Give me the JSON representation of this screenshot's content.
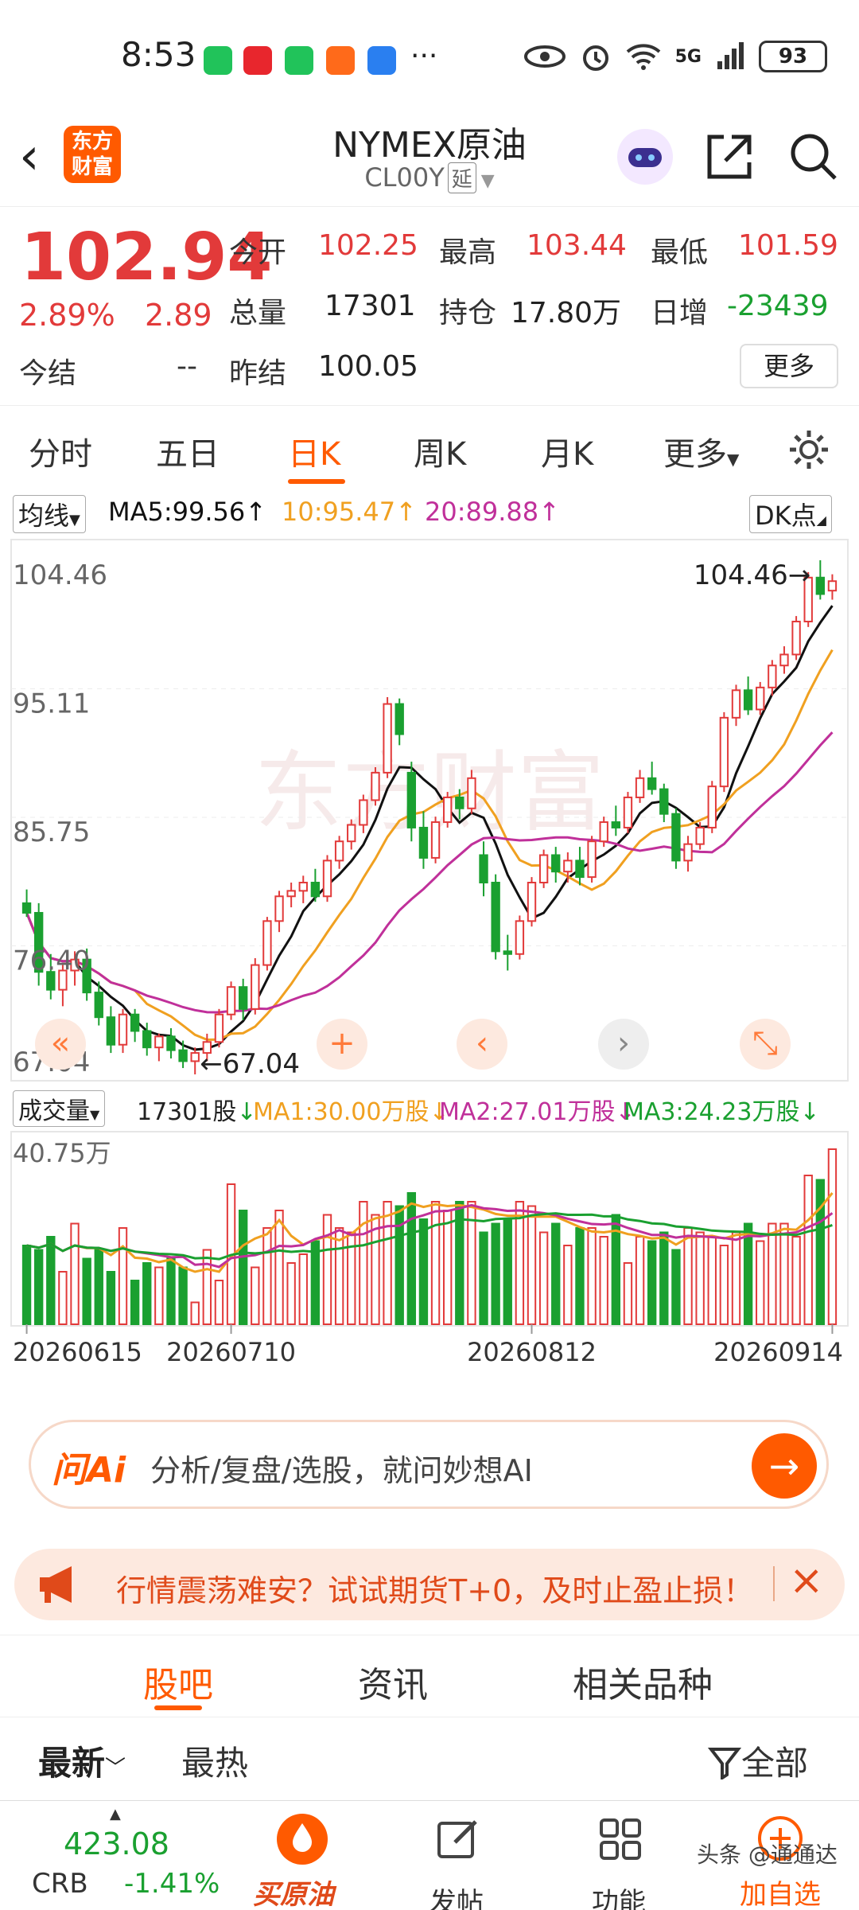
{
  "status_bar": {
    "time": "8:53",
    "more": "···",
    "network": "5G",
    "battery": "93"
  },
  "header": {
    "title": "NYMEX原油",
    "code": "CL00Y",
    "badge": "延",
    "logo_text_top": "东方",
    "logo_text_bottom": "财富"
  },
  "quote": {
    "last": "102.94",
    "change_pct": "2.89%",
    "change": "2.89",
    "open_label": "今开",
    "open": "102.25",
    "high_label": "最高",
    "high": "103.44",
    "low_label": "最低",
    "low": "101.59",
    "volume_label": "总量",
    "volume": "17301",
    "oi_label": "持仓",
    "oi": "17.80万",
    "daily_inc_label": "日增",
    "daily_inc": "-23439",
    "settle_label": "今结",
    "settle": "--",
    "prev_settle_label": "昨结",
    "prev_settle": "100.05",
    "more_button": "更多"
  },
  "tabs": [
    "分时",
    "五日",
    "日K",
    "周K",
    "月K",
    "更多"
  ],
  "ma_bar": {
    "selector": "均线",
    "ma5": "MA5:99.56",
    "ma10": "10:95.47",
    "ma20": "20:89.88",
    "dk": "DK点"
  },
  "colors": {
    "up": "#e23a3a",
    "down": "#1aa030",
    "accent": "#ff5a00",
    "ma5": "#111111",
    "ma10": "#f0a020",
    "ma20": "#c0309a"
  },
  "chart_controls": [
    "«",
    "+",
    "‹",
    "›",
    "⤡"
  ],
  "vol_bar": {
    "selector": "成交量",
    "vol": "17301股",
    "ma1": "MA1:30.00万股",
    "ma2": "MA2:27.01万股",
    "ma3": "MA3:24.23万股"
  },
  "chart_data": {
    "type": "candlestick",
    "price_axis_labels": [
      "104.46",
      "95.11",
      "85.75",
      "76.40",
      "67.04"
    ],
    "ylim": [
      67.04,
      104.46
    ],
    "max_annotation": "104.46",
    "min_annotation": "67.04",
    "date_labels": [
      "20260615",
      "20260710",
      "20260812",
      "20260914"
    ],
    "volume_axis_label": "40.75万",
    "candles": [
      [
        79.5,
        80.5,
        78.5,
        78.8
      ],
      [
        78.8,
        79.5,
        73.5,
        74.5
      ],
      [
        74.5,
        75.8,
        72.5,
        73.2
      ],
      [
        73.2,
        75,
        72,
        74.6
      ],
      [
        74.6,
        76,
        73.5,
        75.4
      ],
      [
        75.4,
        76.2,
        72.4,
        73
      ],
      [
        73,
        73.8,
        70.6,
        71.2
      ],
      [
        71.2,
        72,
        68.6,
        69.2
      ],
      [
        69.2,
        71.8,
        68.6,
        71.4
      ],
      [
        71.4,
        71.8,
        69.4,
        70.2
      ],
      [
        70.2,
        70.8,
        68.4,
        69
      ],
      [
        69,
        70,
        68,
        69.8
      ],
      [
        69.8,
        70.4,
        68.2,
        68.8
      ],
      [
        68.8,
        69.5,
        67.5,
        68
      ],
      [
        68,
        69,
        67.04,
        68.6
      ],
      [
        68.6,
        70,
        68,
        69.4
      ],
      [
        69.4,
        71.8,
        69,
        71.4
      ],
      [
        71.4,
        73.8,
        71,
        73.4
      ],
      [
        73.4,
        74,
        71,
        71.8
      ],
      [
        71.8,
        75.5,
        71.4,
        75
      ],
      [
        75,
        78.5,
        74.6,
        78.2
      ],
      [
        78.2,
        80.4,
        77.4,
        80
      ],
      [
        80,
        81,
        79.2,
        80.4
      ],
      [
        80.4,
        81.5,
        79.5,
        81
      ],
      [
        81,
        82,
        79.6,
        80
      ],
      [
        80,
        83,
        79.6,
        82.6
      ],
      [
        82.6,
        84.4,
        82,
        84
      ],
      [
        84,
        85.6,
        83.4,
        85.2
      ],
      [
        85.2,
        87.4,
        84.6,
        87
      ],
      [
        87,
        89.4,
        86.6,
        89
      ],
      [
        89,
        94.5,
        88.6,
        94
      ],
      [
        94,
        94.4,
        91,
        91.8
      ],
      [
        89,
        89.8,
        84,
        85
      ],
      [
        85,
        86.2,
        82,
        82.8
      ],
      [
        82.8,
        85.8,
        82.4,
        85.4
      ],
      [
        85.4,
        87.6,
        85,
        87.2
      ],
      [
        87.2,
        87.8,
        85.6,
        86.4
      ],
      [
        86.4,
        89.2,
        86,
        88.6
      ],
      [
        83,
        84,
        80,
        81
      ],
      [
        81,
        81.6,
        75.4,
        76
      ],
      [
        76,
        77.2,
        74.6,
        75.8
      ],
      [
        75.8,
        78.6,
        75.4,
        78.2
      ],
      [
        78.2,
        81.4,
        77.8,
        81
      ],
      [
        81,
        83.4,
        80.6,
        83
      ],
      [
        83,
        83.6,
        81,
        81.8
      ],
      [
        81.8,
        83.2,
        81,
        82.6
      ],
      [
        82.6,
        83.6,
        80.8,
        81.4
      ],
      [
        81.4,
        84.4,
        81,
        84
      ],
      [
        84,
        85.8,
        83.6,
        85.4
      ],
      [
        85.4,
        86.6,
        84.4,
        85
      ],
      [
        85,
        87.6,
        84.6,
        87.2
      ],
      [
        87.2,
        89.2,
        86.8,
        88.6
      ],
      [
        88.6,
        89.8,
        87.4,
        87.8
      ],
      [
        87.8,
        88.2,
        85.4,
        86
      ],
      [
        86,
        86.4,
        82,
        82.6
      ],
      [
        82.6,
        84.4,
        81.8,
        83.8
      ],
      [
        83.8,
        85.4,
        83.4,
        85
      ],
      [
        85,
        88.4,
        84.6,
        88
      ],
      [
        88,
        93.4,
        87.6,
        93
      ],
      [
        93,
        95.4,
        92.4,
        95
      ],
      [
        95,
        96,
        93.2,
        93.6
      ],
      [
        93.6,
        95.6,
        93.2,
        95.2
      ],
      [
        95.2,
        97.2,
        94.6,
        96.8
      ],
      [
        96.8,
        98.2,
        96.2,
        97.6
      ],
      [
        97.6,
        100.4,
        97.2,
        100
      ],
      [
        100,
        103.6,
        99.6,
        103.2
      ],
      [
        103.2,
        104.46,
        101.6,
        102
      ],
      [
        102.25,
        103.44,
        101.59,
        102.94
      ]
    ],
    "volumes": [
      18,
      17,
      20,
      12,
      23,
      15,
      17,
      12,
      22,
      10,
      14,
      13,
      15,
      13,
      5,
      17,
      10,
      32,
      26,
      13,
      22,
      26,
      14,
      16,
      19,
      25,
      22,
      21,
      28,
      25,
      28,
      27,
      30,
      24,
      28,
      26,
      28,
      28,
      21,
      23,
      24,
      28,
      27,
      21,
      23,
      18,
      22,
      22,
      20,
      25,
      14,
      20,
      19,
      21,
      17,
      22,
      21,
      20,
      18,
      21,
      23,
      19,
      23,
      23,
      20,
      34,
      33,
      40
    ]
  },
  "ai_search": {
    "logo": "问Ai",
    "placeholder": "分析/复盘/选股，就问妙想AI"
  },
  "ad": {
    "text": "行情震荡难安？试试期货T+0，及时止盈止损！"
  },
  "sub_tabs": [
    "股吧",
    "资讯",
    "相关品种"
  ],
  "sort": {
    "latest": "最新",
    "hot": "最热",
    "filter": "全部"
  },
  "bottom_bar": {
    "index_value": "423.08",
    "index_name": "CRB",
    "index_change": "-1.41%",
    "buy_label": "买原油",
    "post_label": "发帖",
    "function_label": "功能",
    "add_label": "加自选",
    "watermark": "头条 @通通达"
  }
}
